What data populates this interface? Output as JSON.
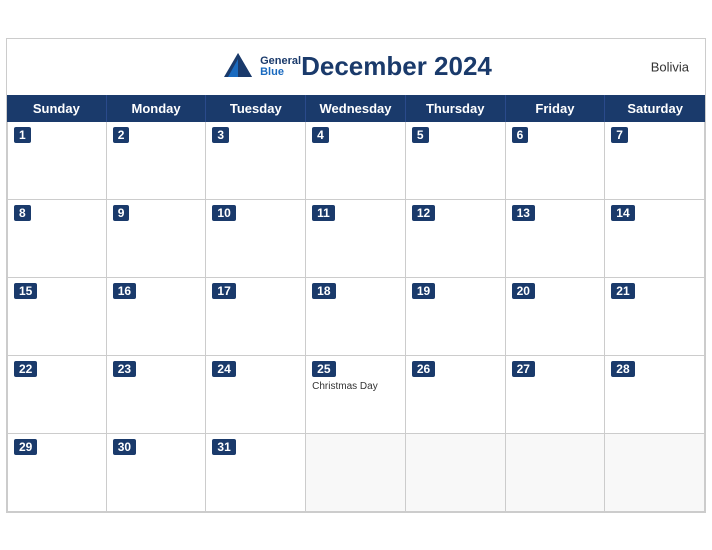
{
  "header": {
    "title": "December 2024",
    "country": "Bolivia",
    "logo_general": "General",
    "logo_blue": "Blue"
  },
  "days_of_week": [
    "Sunday",
    "Monday",
    "Tuesday",
    "Wednesday",
    "Thursday",
    "Friday",
    "Saturday"
  ],
  "weeks": [
    [
      {
        "day": 1,
        "empty": false,
        "events": []
      },
      {
        "day": 2,
        "empty": false,
        "events": []
      },
      {
        "day": 3,
        "empty": false,
        "events": []
      },
      {
        "day": 4,
        "empty": false,
        "events": []
      },
      {
        "day": 5,
        "empty": false,
        "events": []
      },
      {
        "day": 6,
        "empty": false,
        "events": []
      },
      {
        "day": 7,
        "empty": false,
        "events": []
      }
    ],
    [
      {
        "day": 8,
        "empty": false,
        "events": []
      },
      {
        "day": 9,
        "empty": false,
        "events": []
      },
      {
        "day": 10,
        "empty": false,
        "events": []
      },
      {
        "day": 11,
        "empty": false,
        "events": []
      },
      {
        "day": 12,
        "empty": false,
        "events": []
      },
      {
        "day": 13,
        "empty": false,
        "events": []
      },
      {
        "day": 14,
        "empty": false,
        "events": []
      }
    ],
    [
      {
        "day": 15,
        "empty": false,
        "events": []
      },
      {
        "day": 16,
        "empty": false,
        "events": []
      },
      {
        "day": 17,
        "empty": false,
        "events": []
      },
      {
        "day": 18,
        "empty": false,
        "events": []
      },
      {
        "day": 19,
        "empty": false,
        "events": []
      },
      {
        "day": 20,
        "empty": false,
        "events": []
      },
      {
        "day": 21,
        "empty": false,
        "events": []
      }
    ],
    [
      {
        "day": 22,
        "empty": false,
        "events": []
      },
      {
        "day": 23,
        "empty": false,
        "events": []
      },
      {
        "day": 24,
        "empty": false,
        "events": []
      },
      {
        "day": 25,
        "empty": false,
        "events": [
          "Christmas Day"
        ]
      },
      {
        "day": 26,
        "empty": false,
        "events": []
      },
      {
        "day": 27,
        "empty": false,
        "events": []
      },
      {
        "day": 28,
        "empty": false,
        "events": []
      }
    ],
    [
      {
        "day": 29,
        "empty": false,
        "events": []
      },
      {
        "day": 30,
        "empty": false,
        "events": []
      },
      {
        "day": 31,
        "empty": false,
        "events": []
      },
      {
        "day": null,
        "empty": true,
        "events": []
      },
      {
        "day": null,
        "empty": true,
        "events": []
      },
      {
        "day": null,
        "empty": true,
        "events": []
      },
      {
        "day": null,
        "empty": true,
        "events": []
      }
    ]
  ]
}
